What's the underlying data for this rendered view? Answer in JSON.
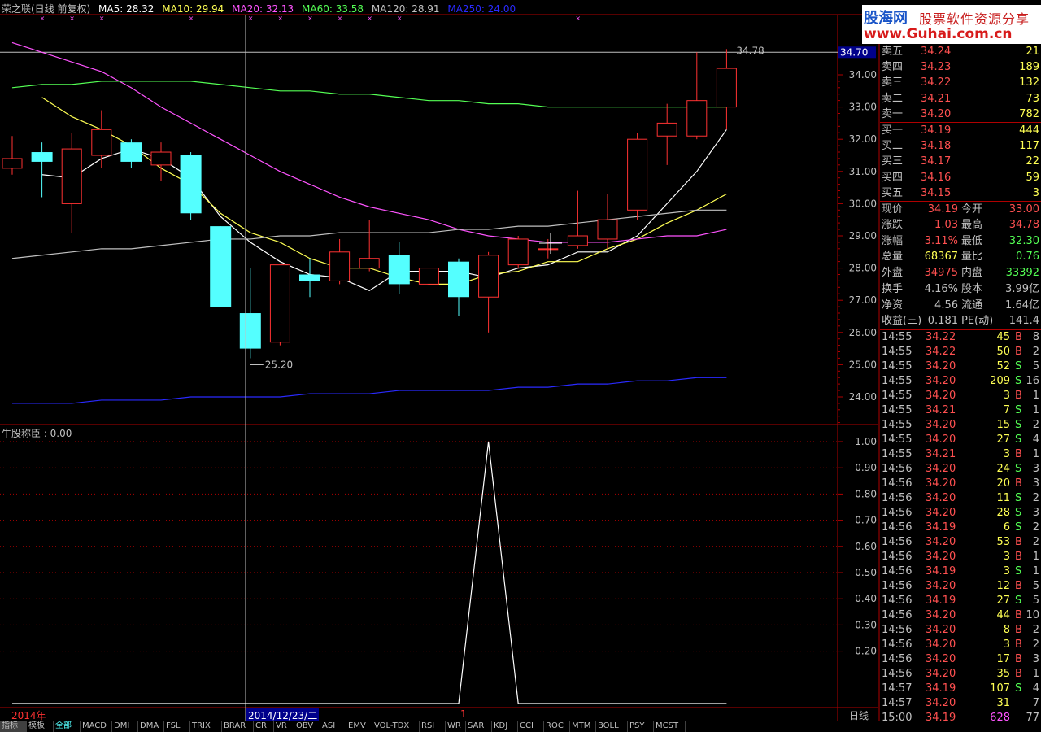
{
  "header": {
    "title": "荣之联(日线 前复权)",
    "ma": [
      {
        "label": "MA5: 28.32",
        "color": "#ffffff"
      },
      {
        "label": "MA10: 29.94",
        "color": "#ffff54"
      },
      {
        "label": "MA20: 32.13",
        "color": "#ff54ff"
      },
      {
        "label": "MA60: 33.58",
        "color": "#54ff54"
      },
      {
        "label": "MA120: 28.91",
        "color": "#c0c0c0"
      },
      {
        "label": "MA250: 24.00",
        "color": "#2a2aff"
      }
    ]
  },
  "indicator_label": "牛股称臣 : 0.00",
  "logo": {
    "line1": "股海网",
    "line2": "股票软件资源分享",
    "line3": "www.Guhai.com.cn"
  },
  "chart_data": [
    {
      "type": "candlestick",
      "ylim": [
        23.6,
        35.2
      ],
      "y_ticks": [
        "34.00",
        "33.00",
        "32.00",
        "31.00",
        "30.00",
        "29.00",
        "28.00",
        "27.00",
        "26.00",
        "25.00",
        "24.00"
      ],
      "y_tick_values": [
        34,
        33,
        32,
        31,
        30,
        29,
        28,
        27,
        26,
        25,
        24
      ],
      "current_price_label": "34.70",
      "high_annotation": "34.78",
      "low_annotation": "25.20",
      "candles": [
        {
          "o": 31.1,
          "c": 31.4,
          "h": 32.1,
          "l": 30.9
        },
        {
          "o": 31.6,
          "c": 31.3,
          "h": 31.9,
          "l": 30.2
        },
        {
          "o": 30.0,
          "c": 31.7,
          "h": 32.2,
          "l": 29.1
        },
        {
          "o": 31.5,
          "c": 32.3,
          "h": 32.9,
          "l": 31.1
        },
        {
          "o": 31.9,
          "c": 31.3,
          "h": 32.0,
          "l": 31.1
        },
        {
          "o": 31.2,
          "c": 31.6,
          "h": 31.9,
          "l": 30.7
        },
        {
          "o": 31.5,
          "c": 29.7,
          "h": 31.6,
          "l": 29.5
        },
        {
          "o": 29.3,
          "c": 26.8,
          "h": 29.3,
          "l": 26.8
        },
        {
          "o": 26.6,
          "c": 25.5,
          "h": 28.0,
          "l": 25.2
        },
        {
          "o": 25.7,
          "c": 28.1,
          "h": 28.1,
          "l": 25.6
        },
        {
          "o": 27.8,
          "c": 27.6,
          "h": 28.3,
          "l": 27.1
        },
        {
          "o": 27.6,
          "c": 28.5,
          "h": 28.9,
          "l": 27.5
        },
        {
          "o": 28.0,
          "c": 28.3,
          "h": 29.5,
          "l": 27.9
        },
        {
          "o": 28.4,
          "c": 27.5,
          "h": 28.8,
          "l": 27.2
        },
        {
          "o": 27.5,
          "c": 28.0,
          "h": 28.0,
          "l": 27.5
        },
        {
          "o": 28.2,
          "c": 27.1,
          "h": 28.3,
          "l": 26.5
        },
        {
          "o": 27.1,
          "c": 28.4,
          "h": 28.5,
          "l": 26.0
        },
        {
          "o": 28.1,
          "c": 28.9,
          "h": 29.0,
          "l": 28.0
        },
        {
          "o": 28.6,
          "c": 28.6,
          "h": 28.9,
          "l": 28.3
        },
        {
          "o": 28.7,
          "c": 29.0,
          "h": 30.4,
          "l": 28.6
        },
        {
          "o": 28.9,
          "c": 29.5,
          "h": 30.3,
          "l": 28.6
        },
        {
          "o": 29.8,
          "c": 32.0,
          "h": 32.2,
          "l": 29.5
        },
        {
          "o": 32.1,
          "c": 32.5,
          "h": 33.1,
          "l": 31.2
        },
        {
          "o": 32.1,
          "c": 33.2,
          "h": 34.7,
          "l": 32.0
        },
        {
          "o": 33.0,
          "c": 34.2,
          "h": 34.8,
          "l": 32.3
        }
      ],
      "series": [
        {
          "name": "MA5",
          "color": "#ffffff",
          "values": [
            null,
            30.9,
            30.8,
            31.4,
            31.7,
            31.4,
            30.8,
            29.6,
            28.8,
            28.2,
            27.8,
            27.7,
            27.3,
            27.9,
            27.9,
            27.9,
            27.7,
            28.0,
            28.1,
            28.5,
            28.5,
            29.0,
            30.0,
            31.0,
            32.3
          ]
        },
        {
          "name": "MA10",
          "color": "#ffff54",
          "values": [
            null,
            33.3,
            32.7,
            32.3,
            31.8,
            31.1,
            30.6,
            29.7,
            29.1,
            28.8,
            28.3,
            28.0,
            28.0,
            27.7,
            27.5,
            27.5,
            27.8,
            27.9,
            28.2,
            28.2,
            28.6,
            28.9,
            29.4,
            29.8,
            30.3
          ]
        },
        {
          "name": "MA20",
          "color": "#ff54ff",
          "values": [
            35.0,
            34.7,
            34.4,
            34.1,
            33.6,
            33.0,
            32.5,
            32.0,
            31.5,
            31.0,
            30.6,
            30.2,
            29.9,
            29.7,
            29.5,
            29.2,
            29.0,
            28.9,
            28.8,
            28.8,
            28.8,
            28.9,
            29.0,
            29.0,
            29.2
          ]
        },
        {
          "name": "MA60",
          "color": "#54ff54",
          "values": [
            33.6,
            33.7,
            33.7,
            33.8,
            33.8,
            33.8,
            33.8,
            33.7,
            33.6,
            33.5,
            33.5,
            33.4,
            33.4,
            33.3,
            33.2,
            33.2,
            33.1,
            33.1,
            33.0,
            33.0,
            33.0,
            33.0,
            33.0,
            33.0,
            33.0
          ]
        },
        {
          "name": "MA120",
          "color": "#c0c0c0",
          "values": [
            28.3,
            28.4,
            28.5,
            28.6,
            28.6,
            28.7,
            28.8,
            28.9,
            28.9,
            29.0,
            29.0,
            29.1,
            29.1,
            29.1,
            29.1,
            29.2,
            29.2,
            29.3,
            29.3,
            29.4,
            29.5,
            29.6,
            29.7,
            29.8,
            29.8
          ]
        },
        {
          "name": "MA250",
          "color": "#2a2aff",
          "values": [
            23.8,
            23.8,
            23.8,
            23.9,
            23.9,
            23.9,
            24.0,
            24.0,
            24.0,
            24.0,
            24.1,
            24.1,
            24.1,
            24.2,
            24.2,
            24.2,
            24.2,
            24.3,
            24.3,
            24.4,
            24.4,
            24.5,
            24.5,
            24.6,
            24.6
          ]
        }
      ]
    },
    {
      "type": "line",
      "title": "牛股称臣",
      "ylim": [
        0,
        1.05
      ],
      "y_ticks": [
        "1.00",
        "0.90",
        "0.80",
        "0.70",
        "0.60",
        "0.50",
        "0.40",
        "0.30",
        "0.20"
      ],
      "y_tick_values": [
        1.0,
        0.9,
        0.8,
        0.7,
        0.6,
        0.5,
        0.4,
        0.3,
        0.2
      ],
      "series": [
        {
          "color": "#ffffff",
          "values": [
            0,
            0,
            0,
            0,
            0,
            0,
            0,
            0,
            0,
            0,
            0,
            0,
            0,
            0,
            0,
            0,
            1,
            0,
            0,
            0,
            0,
            0,
            0,
            0,
            0
          ]
        }
      ]
    }
  ],
  "date_labels": {
    "year": "2014年",
    "crosshair": "2014/12/23/二",
    "mid": "1",
    "period": "日线"
  },
  "order_book": {
    "asks": [
      {
        "label": "卖五",
        "price": "34.24",
        "vol": "21"
      },
      {
        "label": "卖四",
        "price": "34.23",
        "vol": "189"
      },
      {
        "label": "卖三",
        "price": "34.22",
        "vol": "132"
      },
      {
        "label": "卖二",
        "price": "34.21",
        "vol": "73"
      },
      {
        "label": "卖一",
        "price": "34.20",
        "vol": "782"
      }
    ],
    "bids": [
      {
        "label": "买一",
        "price": "34.19",
        "vol": "444"
      },
      {
        "label": "买二",
        "price": "34.18",
        "vol": "117"
      },
      {
        "label": "买三",
        "price": "34.17",
        "vol": "22"
      },
      {
        "label": "买四",
        "price": "34.16",
        "vol": "59"
      },
      {
        "label": "买五",
        "price": "34.15",
        "vol": "3"
      }
    ]
  },
  "quote": [
    {
      "l1": "现价",
      "v1": "34.19",
      "c1": "#ff5050",
      "l2": "今开",
      "v2": "33.00",
      "c2": "#ff5050"
    },
    {
      "l1": "涨跌",
      "v1": "1.03",
      "c1": "#ff5050",
      "l2": "最高",
      "v2": "34.78",
      "c2": "#ff5050"
    },
    {
      "l1": "涨幅",
      "v1": "3.11%",
      "c1": "#ff5050",
      "l2": "最低",
      "v2": "32.30",
      "c2": "#54ff54"
    },
    {
      "l1": "总量",
      "v1": "68367",
      "c1": "#ffff54",
      "l2": "量比",
      "v2": "0.76",
      "c2": "#54ff54"
    },
    {
      "l1": "外盘",
      "v1": "34975",
      "c1": "#ff5050",
      "l2": "内盘",
      "v2": "33392",
      "c2": "#54ff54"
    }
  ],
  "fund": [
    {
      "l1": "换手",
      "v1": "4.16%",
      "l2": "股本",
      "v2": "3.99亿"
    },
    {
      "l1": "净资",
      "v1": "4.56",
      "l2": "流通",
      "v2": "1.64亿"
    },
    {
      "l1": "收益(三)",
      "v1": "0.181",
      "l2": "PE(动)",
      "v2": "141.4"
    }
  ],
  "ticks": [
    {
      "t": "14:55",
      "p": "34.22",
      "v": "45",
      "d": "B",
      "n": "8"
    },
    {
      "t": "14:55",
      "p": "34.22",
      "v": "50",
      "d": "B",
      "n": "2"
    },
    {
      "t": "14:55",
      "p": "34.20",
      "v": "52",
      "d": "S",
      "n": "5"
    },
    {
      "t": "14:55",
      "p": "34.20",
      "v": "209",
      "d": "S",
      "n": "16"
    },
    {
      "t": "14:55",
      "p": "34.20",
      "v": "3",
      "d": "B",
      "n": "1"
    },
    {
      "t": "14:55",
      "p": "34.21",
      "v": "7",
      "d": "S",
      "n": "1"
    },
    {
      "t": "14:55",
      "p": "34.20",
      "v": "15",
      "d": "S",
      "n": "2"
    },
    {
      "t": "14:55",
      "p": "34.20",
      "v": "27",
      "d": "S",
      "n": "4"
    },
    {
      "t": "14:55",
      "p": "34.21",
      "v": "3",
      "d": "B",
      "n": "1"
    },
    {
      "t": "14:56",
      "p": "34.20",
      "v": "24",
      "d": "S",
      "n": "3"
    },
    {
      "t": "14:56",
      "p": "34.20",
      "v": "20",
      "d": "B",
      "n": "3"
    },
    {
      "t": "14:56",
      "p": "34.20",
      "v": "11",
      "d": "S",
      "n": "2"
    },
    {
      "t": "14:56",
      "p": "34.20",
      "v": "28",
      "d": "S",
      "n": "3"
    },
    {
      "t": "14:56",
      "p": "34.19",
      "v": "6",
      "d": "S",
      "n": "2"
    },
    {
      "t": "14:56",
      "p": "34.20",
      "v": "53",
      "d": "B",
      "n": "2"
    },
    {
      "t": "14:56",
      "p": "34.20",
      "v": "3",
      "d": "B",
      "n": "1"
    },
    {
      "t": "14:56",
      "p": "34.19",
      "v": "3",
      "d": "S",
      "n": "1"
    },
    {
      "t": "14:56",
      "p": "34.20",
      "v": "12",
      "d": "B",
      "n": "5"
    },
    {
      "t": "14:56",
      "p": "34.19",
      "v": "27",
      "d": "S",
      "n": "5"
    },
    {
      "t": "14:56",
      "p": "34.20",
      "v": "44",
      "d": "B",
      "n": "10"
    },
    {
      "t": "14:56",
      "p": "34.20",
      "v": "8",
      "d": "B",
      "n": "2"
    },
    {
      "t": "14:56",
      "p": "34.20",
      "v": "3",
      "d": "B",
      "n": "2"
    },
    {
      "t": "14:56",
      "p": "34.20",
      "v": "17",
      "d": "B",
      "n": "3"
    },
    {
      "t": "14:56",
      "p": "34.20",
      "v": "35",
      "d": "B",
      "n": "1"
    },
    {
      "t": "14:57",
      "p": "34.19",
      "v": "107",
      "d": "S",
      "n": "4"
    },
    {
      "t": "14:57",
      "p": "34.20",
      "v": "31",
      "d": "",
      "n": "7"
    },
    {
      "t": "15:00",
      "p": "34.19",
      "v": "628",
      "d": "",
      "n": "77"
    }
  ],
  "tabs": [
    "指标",
    "模板",
    "全部",
    "MACD",
    "DMI",
    "DMA",
    "FSL",
    "TRIX",
    "BRAR",
    "CR",
    "VR",
    "OBV",
    "ASI",
    "EMV",
    "VOL-TDX",
    "RSI",
    "WR",
    "SAR",
    "KDJ",
    "CCI",
    "ROC",
    "MTM",
    "BOLL",
    "PSY",
    "MCST"
  ],
  "colors": {
    "up": "#ff3232",
    "down": "#54ffff",
    "grid": "#b00000",
    "axis": "#c0c0c0"
  }
}
